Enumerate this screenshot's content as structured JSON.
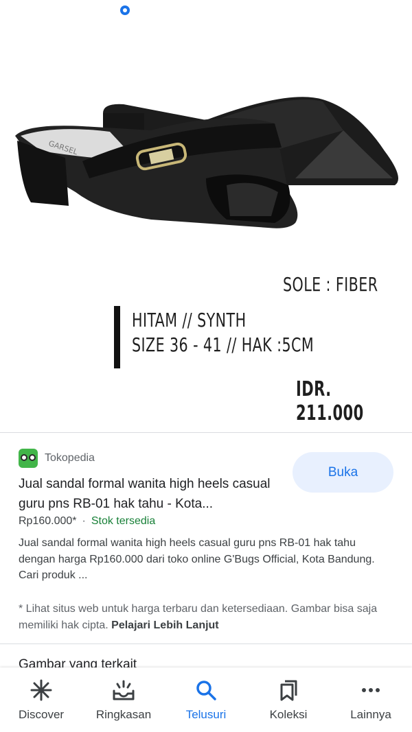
{
  "image": {
    "text_sole": "SOLE : FIBER",
    "text_color": "HITAM // SYNTH",
    "text_size": "SIZE 36 - 41 // HAK :5CM",
    "text_price": "IDR. 211.000",
    "brand_on_insole": "GARSEL"
  },
  "result": {
    "source": "Tokopedia",
    "title": "Jual sandal formal wanita high heels casual guru pns RB-01 hak tahu - Kota...",
    "price": "Rp160.000*",
    "separator": "·",
    "stock": "Stok tersedia",
    "description": "Jual sandal formal wanita high heels casual guru pns RB-01 hak tahu dengan harga Rp160.000 dari toko online G'Bugs Official, Kota Bandung. Cari produk ...",
    "disclaimer": "* Lihat situs web untuk harga terbaru dan ketersediaan. Gambar bisa saja memiliki hak cipta.",
    "learn_more": "Pelajari Lebih Lanjut",
    "open_button": "Buka"
  },
  "related_heading": "Gambar yang terkait",
  "nav": {
    "items": [
      {
        "label": "Discover",
        "icon": "asterisk-icon"
      },
      {
        "label": "Ringkasan",
        "icon": "inbox-sparkle-icon"
      },
      {
        "label": "Telusuri",
        "icon": "search-icon"
      },
      {
        "label": "Koleksi",
        "icon": "bookmarks-icon"
      },
      {
        "label": "Lainnya",
        "icon": "more-horiz-icon"
      }
    ],
    "active": "Telusuri"
  },
  "colors": {
    "accent": "#1a73e8",
    "stock_green": "#188038",
    "button_bg": "#e8f0fe"
  }
}
